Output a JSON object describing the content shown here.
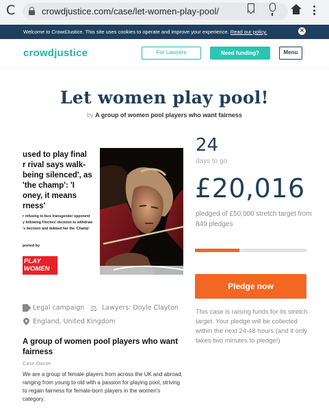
{
  "browser": {
    "url": "crowdjustice.com/case/let-women-play-pool/"
  },
  "cookie_banner": {
    "text": "Welcome to CrowdJustice. This site uses cookies to operate and improve your experience.",
    "link": "Read our policy."
  },
  "header": {
    "logo_part1": "crowd",
    "logo_part2": "justice",
    "lawyers_button": "For Lawyers",
    "funding_button": "Need funding?",
    "menu_button": "Menu"
  },
  "campaign": {
    "title": "Let women play pool!",
    "by_label": "by",
    "author": "A group of women pool players who want fairness",
    "image_headline_lines": [
      "used to play final",
      "r rival says walk-",
      "being silenced', as",
      "'the champ': 'I",
      "oney, it means",
      "rness'"
    ],
    "image_small_lines": [
      "r refusing to face transgender opponent",
      "y following Finches' decision to withdraw",
      "'s decision and dubbed her the 'Champ'"
    ],
    "image_supported": "ported by",
    "image_logo_line1": "PLAY",
    "image_logo_line2": "WOMEN",
    "category": "Legal campaign",
    "lawyers": "Lawyers: Doyle Clayton",
    "location": "England, United Kingdom",
    "owner_name": "A group of women pool players who want fairness",
    "owner_role": "Case Owner",
    "description": "We are a group of female players from across the UK and abroad, ranging from young to old with a passion for playing pool, striving to regain fairness for female-born players in the women's category."
  },
  "stats": {
    "days": "24",
    "days_label": "days to go",
    "amount": "£20,016",
    "pledged_text": "pledged of £50,000 stretch target from 849 pledges",
    "progress_fraction": 0.4,
    "pledge_button": "Pledge now",
    "note": "This case is raising funds for its stretch target. Your pledge will be collected within the next 24-48 hours (and it only takes two minutes to pledge!)"
  },
  "colors": {
    "navy": "#1f3f5e",
    "teal": "#2ec4b0",
    "orange": "#f26722"
  },
  "icons": {
    "reload": "reload-icon",
    "lock": "lock-icon",
    "bookmark": "bookmark-icon",
    "mic": "mic-icon",
    "home": "home-icon",
    "menu": "kebab-menu-icon",
    "close": "close-icon",
    "tag": "tag-icon",
    "scales": "scales-icon",
    "pin": "location-pin-icon"
  }
}
